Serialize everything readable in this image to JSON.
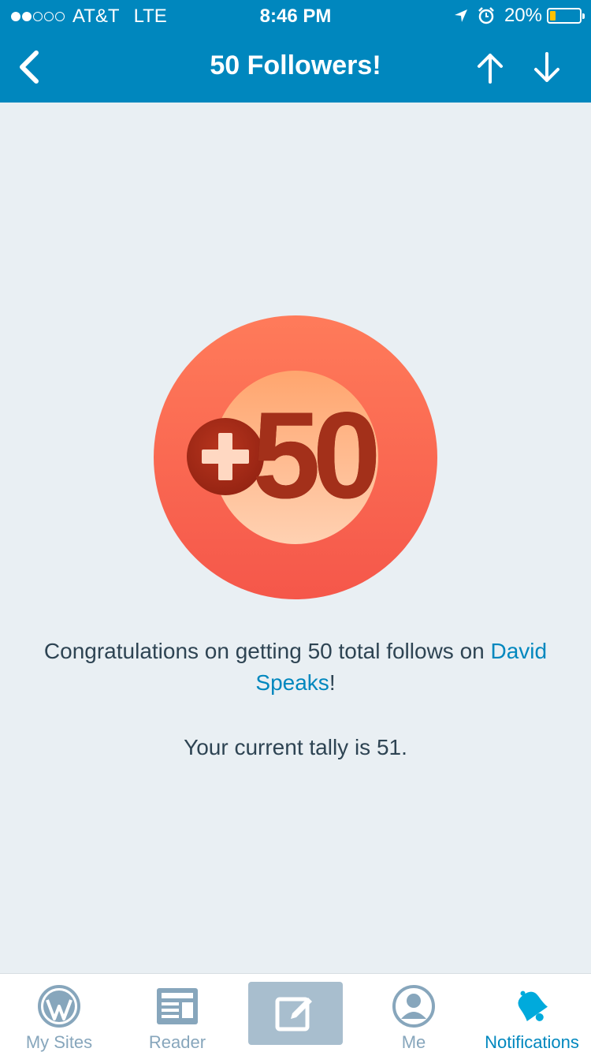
{
  "status_bar": {
    "carrier": "AT&T",
    "network": "LTE",
    "time": "8:46 PM",
    "battery_percent": "20%",
    "signal_bars_filled": 2,
    "signal_bars_total": 5
  },
  "nav": {
    "title": "50 Followers!",
    "back_icon": "chevron-left-icon",
    "up_icon": "arrow-up-icon",
    "down_icon": "arrow-down-icon"
  },
  "badge": {
    "label": "50",
    "icon": "plus-icon"
  },
  "content": {
    "message_prefix": "Congratulations on getting 50 total follows on ",
    "site_link": "David Speaks",
    "message_suffix": "!",
    "tally": "Your current tally is 51."
  },
  "tabs": [
    {
      "label": "My Sites",
      "icon": "wordpress-icon",
      "active": false
    },
    {
      "label": "Reader",
      "icon": "reader-icon",
      "active": false
    },
    {
      "label": "",
      "icon": "compose-icon",
      "active": false
    },
    {
      "label": "Me",
      "icon": "user-icon",
      "active": false
    },
    {
      "label": "Notifications",
      "icon": "bell-icon",
      "active": true
    }
  ],
  "colors": {
    "brand_blue": "#0087be",
    "background": "#e9eff3",
    "text_dark": "#2e4453",
    "tab_inactive": "#87a6bc",
    "battery_low": "#ffc200"
  }
}
